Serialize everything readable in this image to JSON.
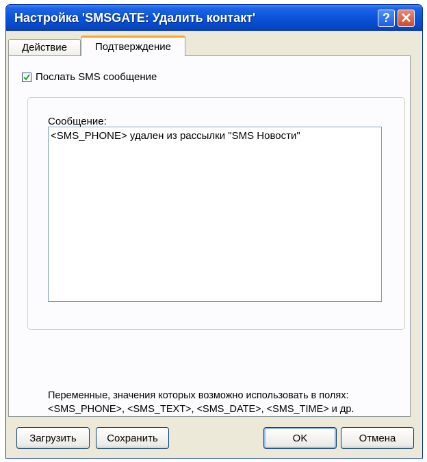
{
  "window": {
    "title": "Настройка 'SMSGATE: Удалить контакт'"
  },
  "title_buttons": {
    "help": "?",
    "close": "✕"
  },
  "tabs": [
    {
      "label": "Действие",
      "active": false
    },
    {
      "label": "Подтверждение",
      "active": true
    }
  ],
  "send_sms": {
    "label": "Послать SMS сообщение",
    "checked": true
  },
  "message": {
    "label": "Сообщение:",
    "value": "<SMS_PHONE> удален из рассылки \"SMS Новости\""
  },
  "variables": {
    "line1": "Переменные, значения которых возможно использовать в полях:",
    "line2": "<SMS_PHONE>, <SMS_TEXT>, <SMS_DATE>, <SMS_TIME> и др."
  },
  "buttons": {
    "load": "Загрузить",
    "save": "Сохранить",
    "ok": "OK",
    "cancel": "Отмена"
  },
  "colors": {
    "titlebar": "#0a53d9",
    "tab_accent": "#f4a62f",
    "dialog_bg": "#ece9d8",
    "checkmark": "#21a121"
  }
}
